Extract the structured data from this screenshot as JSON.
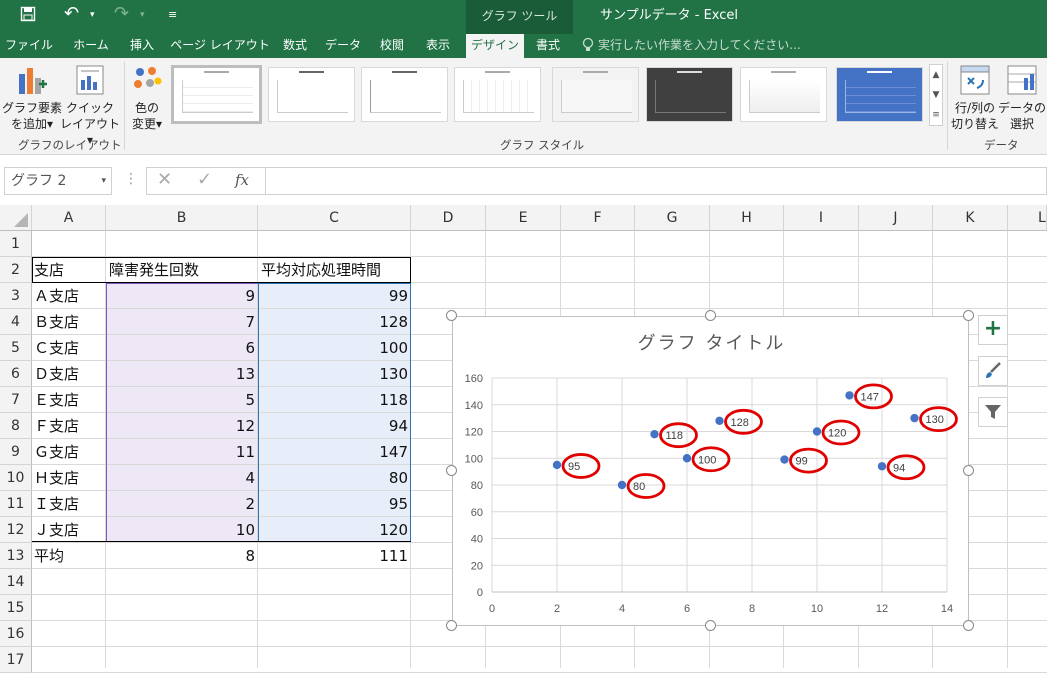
{
  "window": {
    "title": "サンプルデータ - Excel",
    "context_tab": "グラフ ツール"
  },
  "tabs": [
    {
      "label": "ファイル",
      "active": false
    },
    {
      "label": "ホーム",
      "active": false
    },
    {
      "label": "挿入",
      "active": false
    },
    {
      "label": "ページ レイアウト",
      "active": false
    },
    {
      "label": "数式",
      "active": false
    },
    {
      "label": "データ",
      "active": false
    },
    {
      "label": "校閲",
      "active": false
    },
    {
      "label": "表示",
      "active": false
    },
    {
      "label": "デザイン",
      "active": true
    },
    {
      "label": "書式",
      "active": false
    }
  ],
  "tellme": "実行したい作業を入力してください...",
  "ribbon": {
    "add_element_line1": "グラフ要素",
    "add_element_line2": "を追加",
    "quick_layout_line1": "クイック",
    "quick_layout_line2": "レイアウト",
    "color_line1": "色の",
    "color_line2": "変更",
    "group_layout": "グラフのレイアウト",
    "group_styles": "グラフ スタイル",
    "switch_line1": "行/列の",
    "switch_line2": "切り替え",
    "select_line1": "データの",
    "select_line2": "選択",
    "group_data": "データ"
  },
  "formula_bar": {
    "name_box": "グラフ 2",
    "fx": "fx",
    "formula": ""
  },
  "columns": [
    "A",
    "B",
    "C",
    "D",
    "E",
    "F",
    "G",
    "H",
    "I",
    "J",
    "K",
    "L"
  ],
  "rows": [
    "1",
    "2",
    "3",
    "4",
    "5",
    "6",
    "7",
    "8",
    "9",
    "10",
    "11",
    "12",
    "13",
    "14",
    "15",
    "16",
    "17"
  ],
  "table": {
    "headers": [
      "支店",
      "障害発生回数",
      "平均対応処理時間"
    ],
    "rows": [
      [
        "Ａ支店",
        "9",
        "99"
      ],
      [
        "Ｂ支店",
        "7",
        "128"
      ],
      [
        "Ｃ支店",
        "6",
        "100"
      ],
      [
        "Ｄ支店",
        "13",
        "130"
      ],
      [
        "Ｅ支店",
        "5",
        "118"
      ],
      [
        "Ｆ支店",
        "12",
        "94"
      ],
      [
        "Ｇ支店",
        "11",
        "147"
      ],
      [
        "Ｈ支店",
        "4",
        "80"
      ],
      [
        "Ｉ支店",
        "2",
        "95"
      ],
      [
        "Ｊ支店",
        "10",
        "120"
      ]
    ],
    "avg": [
      "平均",
      "8",
      "111"
    ]
  },
  "colors": {
    "excel_green": "#217346",
    "point": "#4472c4",
    "circle": "#e00000",
    "col_b_fill": "#ede7f6",
    "col_c_fill": "#e7eef9"
  },
  "chart_data": {
    "type": "scatter",
    "title": "グラフ タイトル",
    "x": [
      9,
      7,
      6,
      13,
      5,
      12,
      11,
      4,
      2,
      10
    ],
    "y": [
      99,
      128,
      100,
      130,
      118,
      94,
      147,
      80,
      95,
      120
    ],
    "data_labels": [
      "99",
      "128",
      "100",
      "130",
      "118",
      "94",
      "147",
      "80",
      "95",
      "120"
    ],
    "xlim": [
      0,
      14
    ],
    "ylim": [
      0,
      160
    ],
    "xticks": [
      "0",
      "2",
      "4",
      "6",
      "8",
      "10",
      "12",
      "14"
    ],
    "yticks": [
      "0",
      "20",
      "40",
      "60",
      "80",
      "100",
      "120",
      "140",
      "160"
    ],
    "grid": true,
    "annotation": "data labels circled in red"
  }
}
